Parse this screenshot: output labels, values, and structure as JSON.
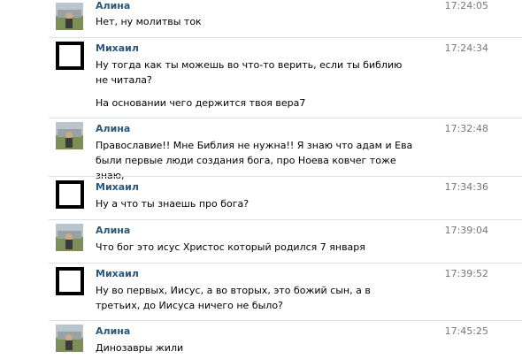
{
  "messages": [
    {
      "author": "Алина",
      "time": "17:24:05",
      "avatar": "photo",
      "lines": [
        "Нет, ну молитвы ток"
      ]
    },
    {
      "author": "Михаил",
      "time": "17:24:34",
      "avatar": "empty",
      "lines": [
        "Ну тогда как ты можешь во что-то верить, если ты библию не читала?",
        "На основании чего держится твоя вера7"
      ]
    },
    {
      "author": "Алина",
      "time": "17:32:48",
      "avatar": "photo",
      "lines": [
        "Православие!! Мне Библия не нужна!! Я знаю что адам и Ева были первые люди создания бога, про Ноева ковчег тоже знаю,"
      ]
    },
    {
      "author": "Михаил",
      "time": "17:34:36",
      "avatar": "empty",
      "lines": [
        "Ну а что ты знаешь про бога?"
      ]
    },
    {
      "author": "Алина",
      "time": "17:39:04",
      "avatar": "photo",
      "lines": [
        "Что бог это исус Христос который родился 7 января"
      ]
    },
    {
      "author": "Михаил",
      "time": "17:39:52",
      "avatar": "empty",
      "lines": [
        "Ну во первых, Иисус, а во вторых, это божий сын, а в третьих, до Иисуса ничего не было?"
      ]
    },
    {
      "author": "Алина",
      "time": "17:45:25",
      "avatar": "photo",
      "lines": [
        "Динозавры жили"
      ]
    }
  ]
}
